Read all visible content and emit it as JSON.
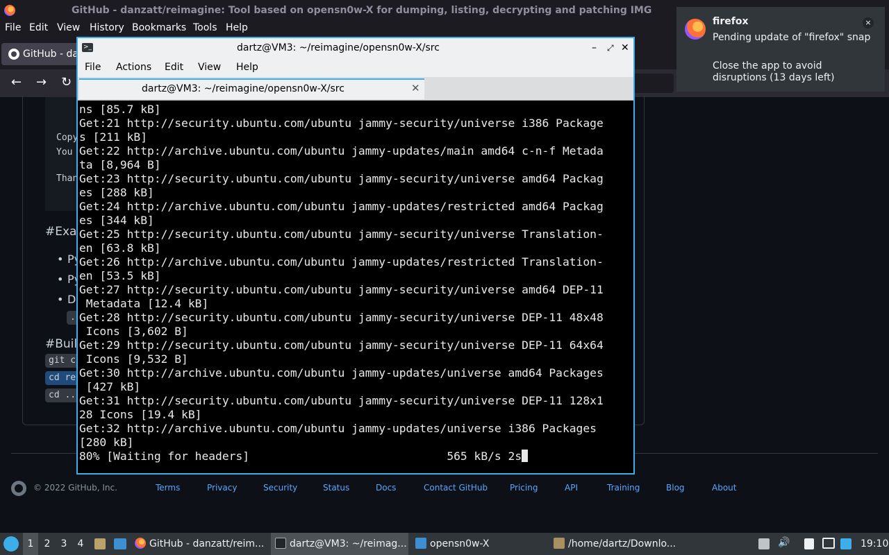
{
  "firefox": {
    "window_title": "GitHub - danzatt/reimagine: Tool based on opensn0w-X for dumping, listing, decrypting and patching IMG",
    "menu": [
      "File",
      "Edit",
      "View",
      "History",
      "Bookmarks",
      "Tools",
      "Help"
    ],
    "tab_label": "GitHub - dan",
    "nav_icons": [
      "back-icon",
      "forward-icon",
      "reload-icon"
    ]
  },
  "github_page": {
    "code_lines": [
      "Copy",
      "You",
      "Than"
    ],
    "heading_examples": "#Exam",
    "bullets": [
      "Py",
      "Py",
      "De"
    ],
    "sub_chip": "..",
    "heading_build": "#Build",
    "build_chips": [
      "git c",
      "cd re",
      "cd .."
    ],
    "footer": {
      "copyright": "© 2022 GitHub, Inc.",
      "links": [
        "Terms",
        "Privacy",
        "Security",
        "Status",
        "Docs",
        "Contact GitHub",
        "Pricing",
        "API",
        "Training",
        "Blog",
        "About"
      ]
    }
  },
  "terminal": {
    "title": "dartz@VM3: ~/reimagine/opensn0w-X/src",
    "menu": [
      "File",
      "Actions",
      "Edit",
      "View",
      "Help"
    ],
    "tab_label": "dartz@VM3: ~/reimagine/opensn0w-X/src",
    "lines": [
      "ns [85.7 kB]",
      "Get:21 http://security.ubuntu.com/ubuntu jammy-security/universe i386 Package",
      "s [211 kB]",
      "Get:22 http://archive.ubuntu.com/ubuntu jammy-updates/main amd64 c-n-f Metada",
      "ta [8,964 B]",
      "Get:23 http://security.ubuntu.com/ubuntu jammy-security/universe amd64 Packag",
      "es [288 kB]",
      "Get:24 http://archive.ubuntu.com/ubuntu jammy-updates/restricted amd64 Packag",
      "es [344 kB]",
      "Get:25 http://security.ubuntu.com/ubuntu jammy-security/universe Translation-",
      "en [63.8 kB]",
      "Get:26 http://archive.ubuntu.com/ubuntu jammy-updates/restricted Translation-",
      "en [53.5 kB]",
      "Get:27 http://security.ubuntu.com/ubuntu jammy-security/universe amd64 DEP-11",
      " Metadata [12.4 kB]",
      "Get:28 http://security.ubuntu.com/ubuntu jammy-security/universe DEP-11 48x48",
      " Icons [3,602 B]",
      "Get:29 http://security.ubuntu.com/ubuntu jammy-security/universe DEP-11 64x64",
      " Icons [9,532 B]",
      "Get:30 http://archive.ubuntu.com/ubuntu jammy-updates/universe amd64 Packages",
      " [427 kB]",
      "Get:31 http://security.ubuntu.com/ubuntu jammy-security/universe DEP-11 128x1",
      "28 Icons [19.4 kB]",
      "Get:32 http://archive.ubuntu.com/ubuntu jammy-updates/universe i386 Packages",
      "[280 kB]"
    ],
    "progress_line": "80% [Waiting for headers]                             565 kB/s 2s"
  },
  "notification": {
    "app": "firefox",
    "message": "Pending update of \"firefox\" snap",
    "detail": "Close the app to avoid disruptions (13 days left)",
    "close_label": "×"
  },
  "taskbar": {
    "workspaces": [
      "1",
      "2",
      "3",
      "4"
    ],
    "tasks": [
      {
        "label": "GitHub - danzatt/reim...",
        "icon": "firefox-icon"
      },
      {
        "label": "dartz@VM3: ~/reimag...",
        "icon": "terminal-icon"
      },
      {
        "label": "opensn0w-X",
        "icon": "folder-icon"
      },
      {
        "label": "/home/dartz/Downlo...",
        "icon": "archive-icon"
      }
    ],
    "clock": "19:10"
  },
  "colors": {
    "accent": "#3daee9",
    "github_bg": "#0d1117",
    "github_link": "#58a6ff",
    "terminal_bg": "#000000"
  }
}
